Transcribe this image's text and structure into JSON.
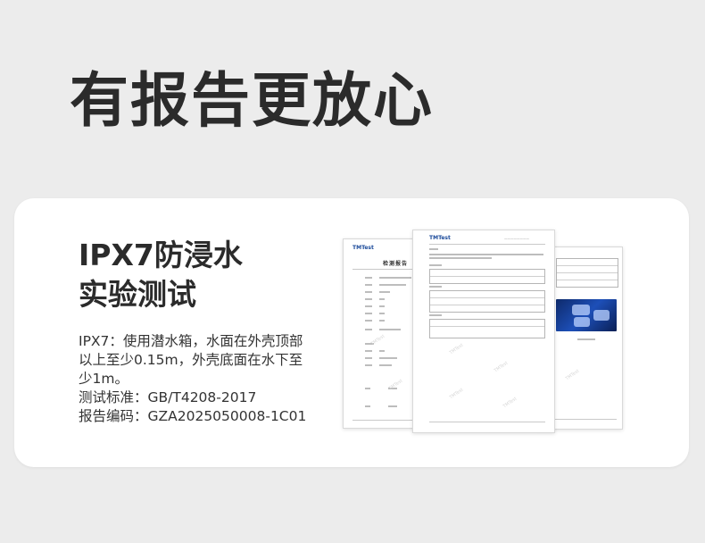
{
  "headline": "有报告更放心",
  "card": {
    "title_line1": "IPX7防浸水",
    "title_line2": "实验测试",
    "desc_lines": [
      "IPX7：使用潜水箱，水面在外壳顶部",
      "以上至少0.15m，外壳底面在水下至",
      "少1m。",
      "测试标准：GB/T4208-2017",
      "报告编码：GZA2025050008-1C01"
    ]
  },
  "report": {
    "logo": "TMTest",
    "title": "检测报告"
  }
}
